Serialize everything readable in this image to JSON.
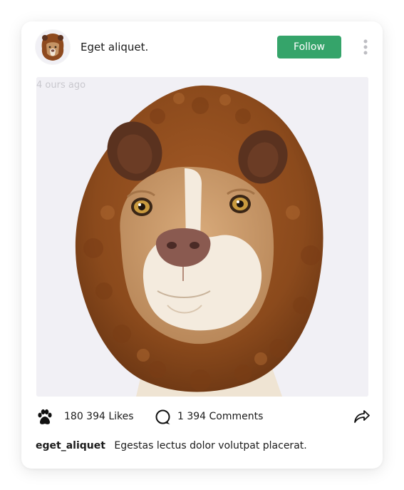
{
  "post": {
    "username": "Eget aliquet.",
    "follow_label": "Follow",
    "timestamp": "4 ours ago",
    "likes": "180 394 Likes",
    "comments": "1 394 Comments",
    "caption_user": "eget_aliquet",
    "caption_text": "Egestas lectus dolor volutpat placerat."
  },
  "icons": {
    "more": "more-vertical-icon",
    "likes": "paw-icon",
    "comments": "comment-icon",
    "share": "share-icon"
  },
  "colors": {
    "follow_button": "#35a46a",
    "media_background": "#f1f0f5",
    "fur": "#8e4a1f",
    "text": "#1b1b1b",
    "timestamp": "#c9c8ce"
  }
}
